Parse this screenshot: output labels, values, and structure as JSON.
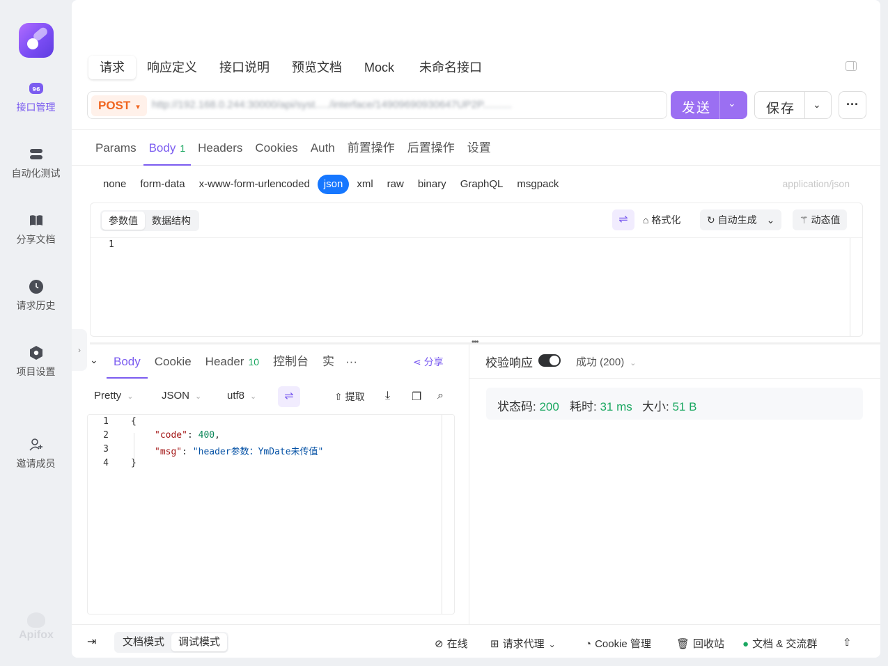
{
  "rail": {
    "items": [
      {
        "label": "接口管理",
        "icon": "api-management-icon",
        "active": true
      },
      {
        "label": "自动化测试",
        "icon": "automation-test-icon",
        "active": false
      },
      {
        "label": "分享文档",
        "icon": "share-docs-icon",
        "active": false
      },
      {
        "label": "请求历史",
        "icon": "history-icon",
        "active": false
      },
      {
        "label": "项目设置",
        "icon": "project-settings-icon",
        "active": false
      },
      {
        "label": "邀请成员",
        "icon": "invite-member-icon",
        "active": false
      }
    ],
    "brand": "Apifox"
  },
  "top_tabs": [
    "请求",
    "响应定义",
    "接口说明",
    "预览文档",
    "Mock",
    "未命名接口"
  ],
  "request": {
    "method": "POST",
    "url": "http://192.168.0.244:30000/api/syst...../interface/14909690930647UP2P..........",
    "send_label": "发送",
    "save_label": "保存"
  },
  "req_tabs": [
    {
      "label": "Params",
      "badge": ""
    },
    {
      "label": "Body",
      "badge": "1"
    },
    {
      "label": "Headers",
      "badge": ""
    },
    {
      "label": "Cookies",
      "badge": ""
    },
    {
      "label": "Auth",
      "badge": ""
    },
    {
      "label": "前置操作",
      "badge": ""
    },
    {
      "label": "后置操作",
      "badge": ""
    },
    {
      "label": "设置",
      "badge": ""
    }
  ],
  "body_types": [
    "none",
    "form-data",
    "x-www-form-urlencoded",
    "json",
    "xml",
    "raw",
    "binary",
    "GraphQL",
    "msgpack"
  ],
  "body_type_selected": "json",
  "content_type": "application/json",
  "editor": {
    "seg": [
      "参数值",
      "数据结构"
    ],
    "format_label": "格式化",
    "autogen_label": "自动生成",
    "dynamic_label": "动态值",
    "line1": "1"
  },
  "response": {
    "tabs": [
      {
        "label": "Body",
        "badge": ""
      },
      {
        "label": "Cookie",
        "badge": ""
      },
      {
        "label": "Header",
        "badge": "10"
      },
      {
        "label": "控制台",
        "badge": ""
      },
      {
        "label": "实",
        "badge": ""
      }
    ],
    "more": "···",
    "share_label": "分享",
    "format": {
      "pretty": "Pretty",
      "lang": "JSON",
      "encoding": "utf8",
      "extract": "提取"
    },
    "code": {
      "l1": "{",
      "l2_key": "\"code\"",
      "l2_val": "400",
      "l3_key": "\"msg\"",
      "l3_val": "\"header参数：YmDate未传值\"",
      "l4": "}"
    },
    "verify_label": "校验响应",
    "status_select": "成功 (200)",
    "stats": {
      "status_label": "状态码:",
      "status_value": "200",
      "time_label": "耗时:",
      "time_value": "31 ms",
      "size_label": "大小:",
      "size_value": "51 B"
    }
  },
  "footer": {
    "mode_doc": "文档模式",
    "mode_debug": "调试模式",
    "online": "在线",
    "proxy": "请求代理",
    "cookie": "Cookie 管理",
    "recycle": "回收站",
    "docs": "文档 & 交流群"
  },
  "colors": {
    "accent": "#7b5cf0",
    "method": "#f0651f",
    "success": "#1aa760",
    "json_pill": "#1677ff"
  }
}
